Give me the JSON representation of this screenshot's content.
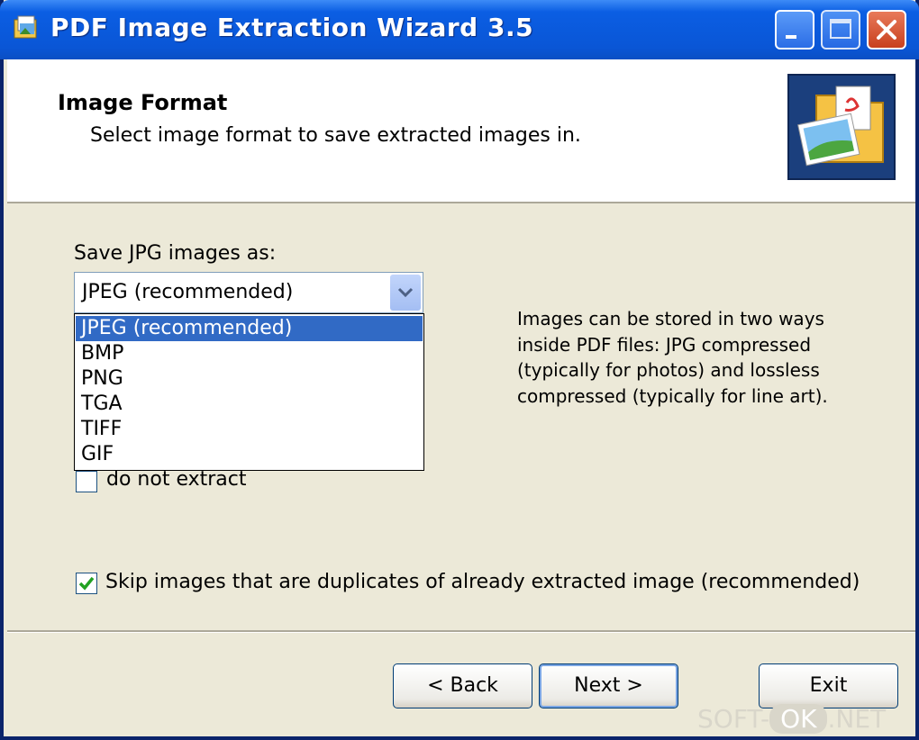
{
  "window": {
    "title": "PDF Image Extraction Wizard 3.5",
    "controls": {
      "minimize": "minimize",
      "maximize": "maximize",
      "close": "close"
    }
  },
  "header": {
    "title": "Image Format",
    "subtitle": "Select image format to save extracted images in."
  },
  "format": {
    "label": "Save JPG images as:",
    "selected": "JPEG (recommended)",
    "options": [
      "JPEG (recommended)",
      "BMP",
      "PNG",
      "TGA",
      "TIFF",
      "GIF"
    ]
  },
  "do_not_extract": {
    "label": "do not extract",
    "checked": false
  },
  "info_text": "Images can be stored in two ways inside PDF files: JPG compressed (typically for photos) and lossless compressed (typically for line art).",
  "skip_duplicates": {
    "label": "Skip images that are duplicates of already extracted image (recommended)",
    "checked": true
  },
  "buttons": {
    "back": "< Back",
    "next": "Next >",
    "exit": "Exit"
  },
  "watermark": {
    "left": "SOFT-",
    "ok": "OK",
    "right": ".NET"
  },
  "colors": {
    "titlebar": "#0a56d6",
    "selection": "#316ac5",
    "face": "#ece9d8",
    "check": "#21a121"
  }
}
